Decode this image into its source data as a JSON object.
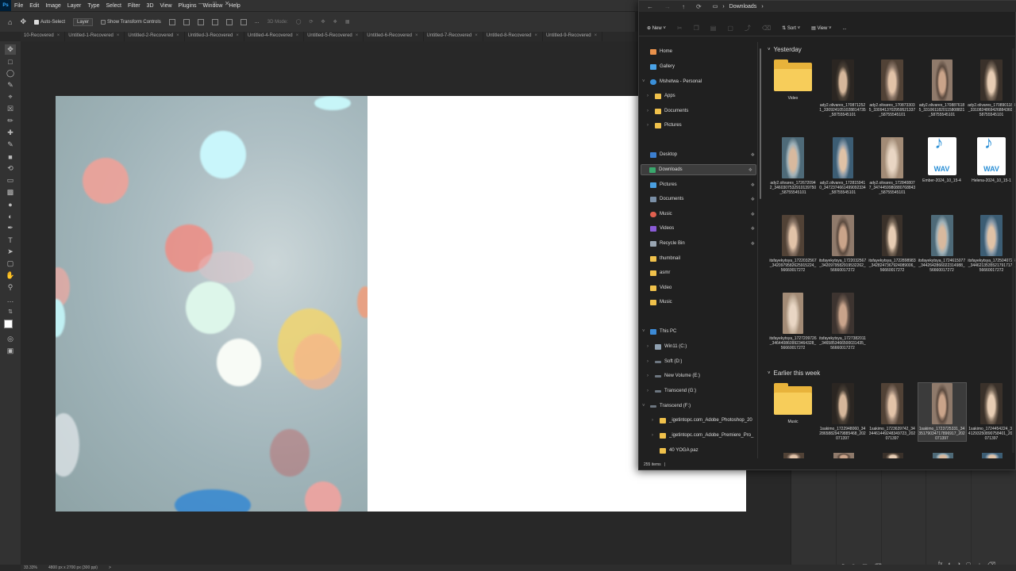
{
  "photoshop": {
    "logo": "Ps",
    "menu": [
      "File",
      "Edit",
      "Image",
      "Layer",
      "Type",
      "Select",
      "Filter",
      "3D",
      "View",
      "Plugins",
      "Window",
      "Help"
    ],
    "options": {
      "auto_select_label": "Auto-Select",
      "layer_select_value": "Layer",
      "show_transform_label": "Show Transform Controls",
      "mode_3d_label": "3D Mode:"
    },
    "tabs": [
      "10-Recovered",
      "Untitled-1-Recovered",
      "Untitled-2-Recovered",
      "Untitled-3-Recovered",
      "Untitled-4-Recovered",
      "Untitled-5-Recovered",
      "Untitled-6-Recovered",
      "Untitled-7-Recovered",
      "Untitled-8-Recovered",
      "Untitled-9-Recovered"
    ],
    "status": {
      "zoom": "33.33%",
      "doc_size": "4800 px x 2700 px (300 ppi)",
      "arrow": ">"
    }
  },
  "explorer": {
    "address": "Downloads",
    "toolbar": {
      "new_label": "New",
      "sort_label": "Sort",
      "view_label": "View",
      "more_label": "..."
    },
    "nav": {
      "home": "Home",
      "gallery": "Gallery",
      "personal": "Mshetwa - Personal",
      "apps": "Apps",
      "documents": "Documents",
      "pictures": "Pictures",
      "desktop": "Desktop",
      "downloads": "Downloads",
      "pictures2": "Pictures",
      "documents2": "Documents",
      "music": "Music",
      "videos": "Videos",
      "recycle": "Recycle Bin",
      "thumbnail": "thumbnail",
      "asmr": "asmr",
      "video": "Video",
      "music2": "Music",
      "this_pc": "This PC",
      "win11": "Win11 (C:)",
      "soft": "Soft (D:)",
      "newvol": "New Volume (E:)",
      "transcend_g": "Transcend (G:)",
      "transcend_f": "Transcend (F:)",
      "igetintopc_ps": "_igetintopc.com_Adobe_Photoshop_20",
      "igetintopc_pr": "_igetintopc.com_Adobe_Premiere_Pro_",
      "yoga": "40 YOGA paz"
    },
    "groups": {
      "yesterday": "Yesterday",
      "earlier": "Earlier this week"
    },
    "files_yesterday": [
      {
        "name": "Video",
        "kind": "folder"
      },
      {
        "name": "ady2.olivares_1708712521_3309241051028814735_58755545101",
        "kind": "photo"
      },
      {
        "name": "ady2.olivares_1708733035_3309413702959521337_58755545101",
        "kind": "photo"
      },
      {
        "name": "ady2.olivares_1708876185_3310611820115808821_58755545101",
        "kind": "photo"
      },
      {
        "name": "ady2.olivares_1708901188_3310824869426884360_58755545101",
        "kind": "photo"
      },
      {
        "name": "ady2.olivares_1726720942_3460307532910139750_58755545101",
        "kind": "photo"
      },
      {
        "name": "ady2.olivares_1728159410_3472374661499092334_58755545101",
        "kind": "photo"
      },
      {
        "name": "ady2.olivares_1728408077_3474459980880768843_58755545101",
        "kind": "photo"
      },
      {
        "name": "Ember-2024_10_15-4",
        "kind": "wav"
      },
      {
        "name": "Helena-2024_10_15-1",
        "kind": "wav"
      },
      {
        "name": "itsfayekytsya_1722032567_3420979582625915224_56660017272",
        "kind": "photo"
      },
      {
        "name": "itsfayekytsya_1722032567_3420979582919532262_56660017272",
        "kind": "photo"
      },
      {
        "name": "itsfayekytsya_1722898983_3428247367924089006_56660017272",
        "kind": "photo"
      },
      {
        "name": "itsfayekytsya_1724615077_3442642866022314988_56660017272",
        "kind": "photo"
      },
      {
        "name": "itsfayekytsya_1725040723_3446213535521791717_56660017272",
        "kind": "photo"
      },
      {
        "name": "itsfayekytsya_1727209726_3464408609923464328_56660017272",
        "kind": "photo"
      },
      {
        "name": "itsfayekytsya_1727382011_3465853466500031435_56660017272",
        "kind": "photo"
      }
    ],
    "files_earlier": [
      {
        "name": "Music",
        "kind": "folder"
      },
      {
        "name": "1sakimo_1722948060_3428658829479885468_202071397",
        "kind": "photo"
      },
      {
        "name": "1sakimo_1723639742_3434461449248349723_202071397",
        "kind": "photo"
      },
      {
        "name": "1sakimo_1723725331_3435179034717896917_202071397",
        "kind": "photo"
      },
      {
        "name": "1sakimo_1724454224_3441293250890758401_202071397",
        "kind": "photo"
      }
    ],
    "status_count": "255 items",
    "status_sep": "|"
  },
  "colors": {
    "ps_bg": "#282828",
    "explorer_bg": "#202020",
    "folder": "#f7cd5a",
    "accent": "#31a8ff"
  }
}
